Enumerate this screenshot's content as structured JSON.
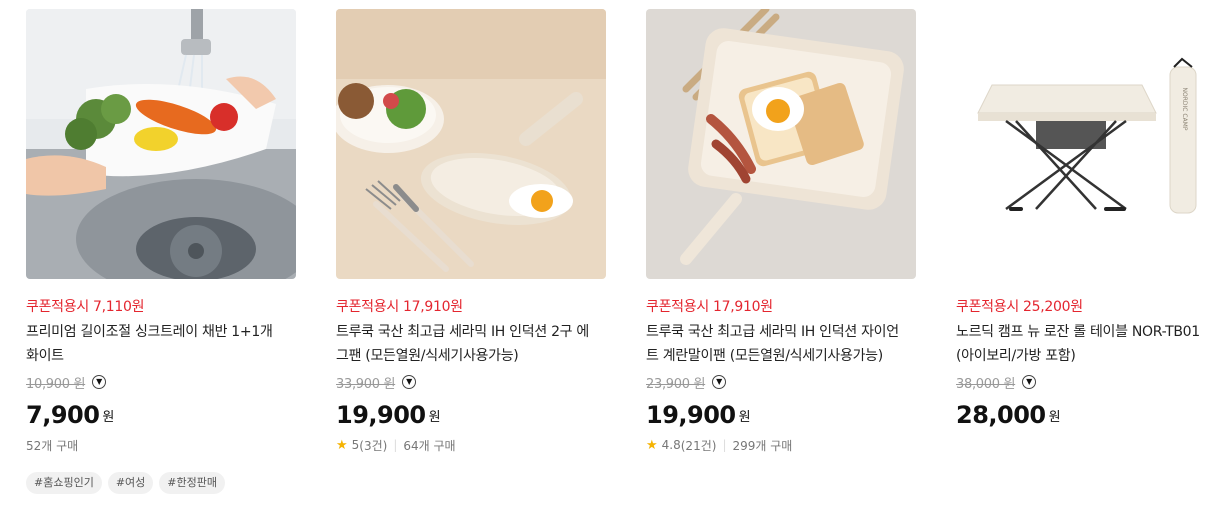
{
  "products": [
    {
      "image_alt": "sink tray with vegetables",
      "coupon": "쿠폰적용시 7,110원",
      "title_line1": "프리미엄 길이조절 싱크트레이 채반 1+1개",
      "title_line2": "화이트",
      "original_price": "10,900 원",
      "price": "7,900",
      "currency": "원",
      "purchases": "52개 구매",
      "tags": [
        "#홈쇼핑인기",
        "#여성",
        "#한정판매"
      ]
    },
    {
      "image_alt": "ceramic 2-section egg pan",
      "coupon": "쿠폰적용시 17,910원",
      "title_line1": "트루쿡 국산 최고급 세라믹 IH 인덕션 2구 에",
      "title_line2": "그팬 (모든열원/식세기사용가능)",
      "original_price": "33,900 원",
      "price": "19,900",
      "currency": "원",
      "rating": "5",
      "review_count": "(3건)",
      "purchases": "64개 구매"
    },
    {
      "image_alt": "ceramic square egg roll pan",
      "coupon": "쿠폰적용시 17,910원",
      "title_line1": "트루쿡 국산 최고급 세라믹 IH 인덕션 자이언",
      "title_line2": "트 계란말이팬 (모든열원/식세기사용가능)",
      "original_price": "23,900 원",
      "price": "19,900",
      "currency": "원",
      "rating": "4.8",
      "review_count": "(21건)",
      "purchases": "299개 구매"
    },
    {
      "image_alt": "folding camping table with bag",
      "coupon": "쿠폰적용시 25,200원",
      "title_line1": "노르딕 캠프 뉴 로잔 롤 테이블 NOR-TB01",
      "title_line2": "(아이보리/가방 포함)",
      "original_price": "38,000 원",
      "price": "28,000",
      "currency": "원",
      "bag_logo": "NORDIC CAMP"
    }
  ],
  "colors": {
    "coupon": "#e4262f",
    "star": "#f5b301"
  },
  "icons": {
    "dropdown": "chevron-down-circle-icon",
    "rating": "star-icon"
  }
}
